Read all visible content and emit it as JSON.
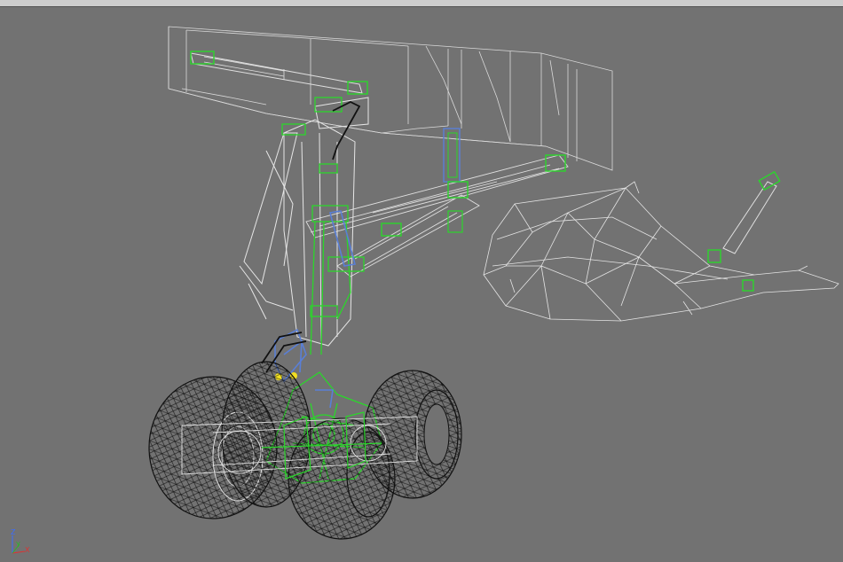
{
  "viewport": {
    "topbar_label": "",
    "background": "#727272",
    "wire_colors": {
      "mesh": "#e6e6e6",
      "tire": "#111111",
      "hydraulic": "#2bd62b",
      "actuator": "#5a7fd6",
      "pin": "#f2e021"
    }
  },
  "gizmo": {
    "z_label": "Z",
    "y_label": "Y",
    "x_label": "X"
  }
}
